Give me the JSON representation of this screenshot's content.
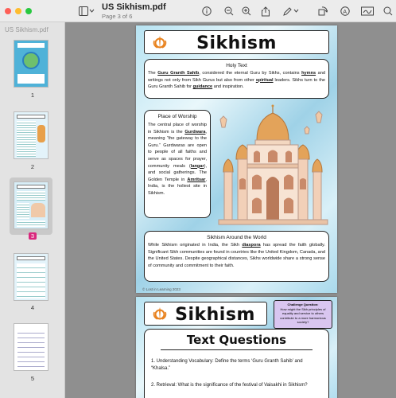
{
  "window": {
    "title": "US Sikhism.pdf",
    "subtitle": "Page 3 of 6"
  },
  "sidebar": {
    "header": "US Sikhism.pdf",
    "pages": [
      {
        "num": "1"
      },
      {
        "num": "2"
      },
      {
        "num": "3",
        "selected": true
      },
      {
        "num": "4"
      },
      {
        "num": "5"
      }
    ]
  },
  "page3": {
    "banner_title": "Sikhism",
    "holy_text": {
      "heading": "Holy Text",
      "text_parts": [
        "The ",
        "Guru Granth Sahib",
        ", considered the eternal Guru by Sikhs, contains ",
        "hymns",
        " and writings not only from Sikh Gurus but also from other ",
        "spiritual",
        " leaders. Sikhs turn to the Guru Granth Sahib for ",
        "guidance",
        " and inspiration."
      ]
    },
    "worship": {
      "heading": "Place of Worship",
      "text_parts": [
        "The central place of worship in Sikhism is the ",
        "Gurdwara",
        ", meaning “the gateway to the Guru.” Gurdwaras are open to people of all faiths and serve as spaces for prayer, community meals (",
        "langar",
        "), and social gatherings. The Golden Temple in ",
        "Amritsar",
        ", India, is the holiest site in Sikhism."
      ]
    },
    "around_world": {
      "heading": "Sikhism Around the World",
      "text_parts": [
        "While Sikhism originated in India, the Sikh ",
        "diaspora",
        " has spread the faith globally. Significant Sikh communities are found in countries like the United Kingdom, Canada, and the United States. Despite geographical distances, Sikhs worldwide share a strong sense of community and commitment to their faith."
      ]
    },
    "footer": "© Lost in Learning 2023"
  },
  "page4": {
    "banner_title": "Sikhism",
    "challenge": {
      "heading": "Challenge Question:",
      "text": "How might the Sikh principles of equality and service to others contribute to a more harmonious society?"
    },
    "section_title": "Text Questions",
    "questions": [
      "1. Understanding Vocabulary: Define the terms ‘Guru Granth Sahib’ and “Khalsa.”",
      "2. Retrieval: What is the significance of the festival of Vaisakhi in Sikhism?"
    ]
  }
}
